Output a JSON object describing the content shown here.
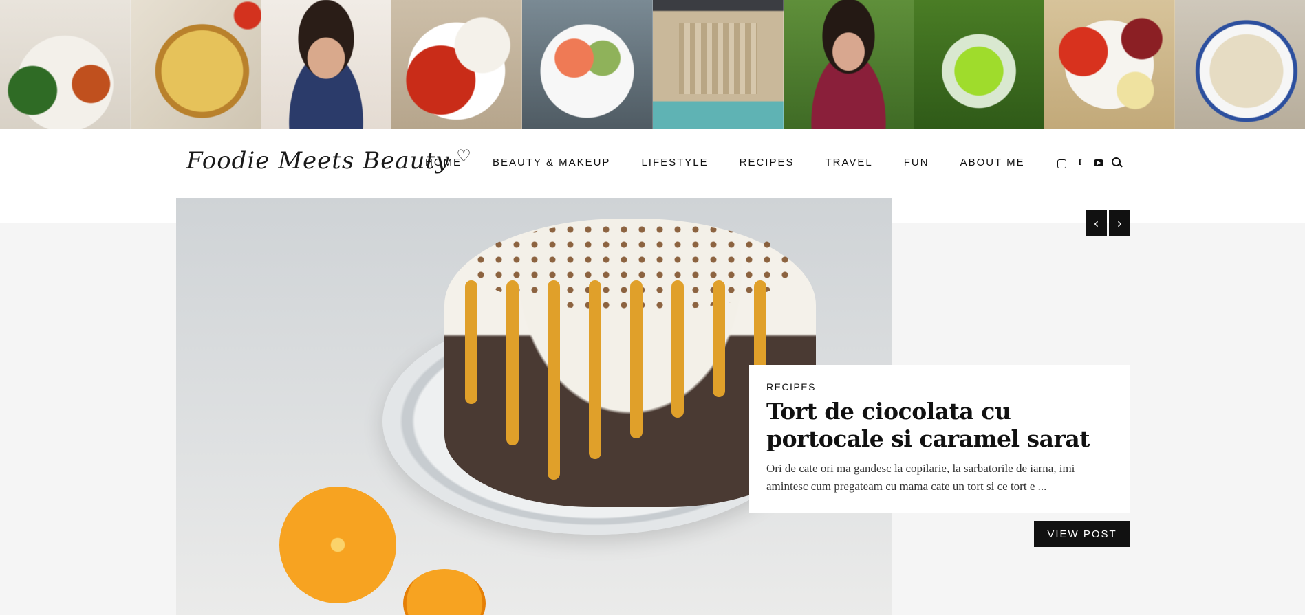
{
  "instagram_feed": [
    {
      "alt": "salad-plate-photo"
    },
    {
      "alt": "quiche-photo"
    },
    {
      "alt": "selfie-photo"
    },
    {
      "alt": "tomato-burrata-photo"
    },
    {
      "alt": "salmon-salad-photo"
    },
    {
      "alt": "trevi-fountain-photo"
    },
    {
      "alt": "park-selfie-photo"
    },
    {
      "alt": "pesto-blender-photo"
    },
    {
      "alt": "tomato-bresaola-photo"
    },
    {
      "alt": "pasta-plate-photo"
    }
  ],
  "header": {
    "logo_text": "Foodie Meets Beauty",
    "logo_heart": "♡",
    "nav": [
      "HOME",
      "BEAUTY & MAKEUP",
      "LIFESTYLE",
      "RECIPES",
      "TRAVEL",
      "FUN",
      "ABOUT ME"
    ],
    "social_icons": [
      "instagram-icon",
      "facebook-icon",
      "youtube-icon",
      "search-icon"
    ]
  },
  "slider": {
    "prev_arrow": "‹",
    "next_arrow": "›",
    "category": "RECIPES",
    "title": "Tort de ciocolata cu portocale si caramel sarat",
    "excerpt": "Ori de cate ori ma gandesc la copilarie, la sarbatorile de iarna, imi amintesc cum pregateam cu mama cate un tort si ce tort e ...",
    "button_label": "VIEW POST"
  },
  "colors": {
    "accent_dark": "#111111",
    "background": "#f5f5f5",
    "header_bg": "#ffffff"
  }
}
